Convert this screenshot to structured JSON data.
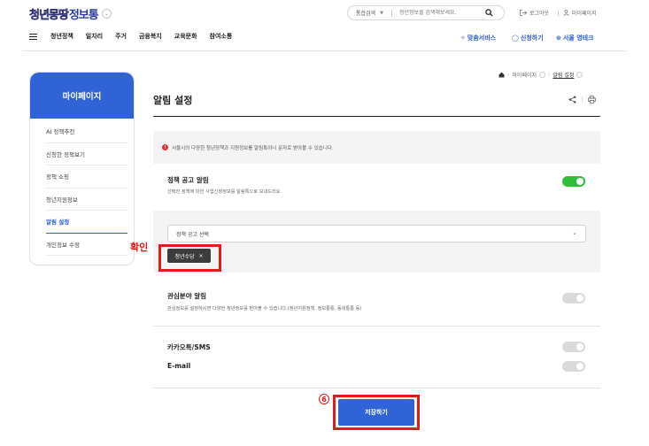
{
  "header": {
    "logo_part1": "청년몽땅",
    "logo_part2": "정보통",
    "search": {
      "scope": "통합검색",
      "placeholder": "청년정보를 검색해보세요."
    },
    "logout": "로그아웃",
    "mypage": "마이페이지",
    "gnb": [
      "청년정책",
      "일자리",
      "주거",
      "금융복지",
      "교육문화",
      "참여소통"
    ],
    "right_links": [
      "맞춤서비스",
      "신청하기",
      "서울 영테크"
    ]
  },
  "sidebar": {
    "title": "마이페이지",
    "items": [
      {
        "label": "AI 정책추천"
      },
      {
        "label": "신청한 정책보기"
      },
      {
        "label": "정책 쇼핑"
      },
      {
        "label": "청년지원정보"
      },
      {
        "label": "알림 설정"
      },
      {
        "label": "개인정보 수정"
      }
    ]
  },
  "breadcrumb": {
    "items": [
      "마이페이지",
      "알림 설정"
    ]
  },
  "main": {
    "title": "알림 설정",
    "notice": "서울시의 다양한 청년정책과 지원정보를 알림톡이나 문자로 받아볼 수 있습니다.",
    "policy_alert": {
      "title": "정책 공고 알림",
      "desc": "선택한 정책에 대한 사업신청정보를 알림톡으로 보내드리요.",
      "enabled": true
    },
    "policy_select": {
      "label": "정책 공고 선택",
      "selected_tag": "청년수당"
    },
    "interest_alert": {
      "title": "관심분야 알림",
      "desc": "관심정보를 설정하시면 다양한 청년정보를 받아볼 수 있습니다.(청년지원정책, 정보통통, 동네통통 등)",
      "enabled": false
    },
    "channels": [
      {
        "label": "카카오톡/SMS",
        "enabled": false
      },
      {
        "label": "E-mail",
        "enabled": false
      }
    ],
    "save_label": "저장하기"
  },
  "annotations": {
    "confirm_label": "확인",
    "step_number": "⑥",
    "highlight_color": "#e41b1b"
  },
  "colors": {
    "brand_blue": "#2f63d6",
    "toggle_on": "#2fbe3a",
    "toggle_off": "#dadada"
  },
  "icons": [
    "home-icon",
    "search-icon",
    "logout-icon",
    "user-icon",
    "share-icon",
    "print-icon",
    "alert-icon",
    "chevron-down-icon",
    "close-icon",
    "pin-icon",
    "chat-icon",
    "circle-check-icon",
    "hamburger-icon"
  ]
}
